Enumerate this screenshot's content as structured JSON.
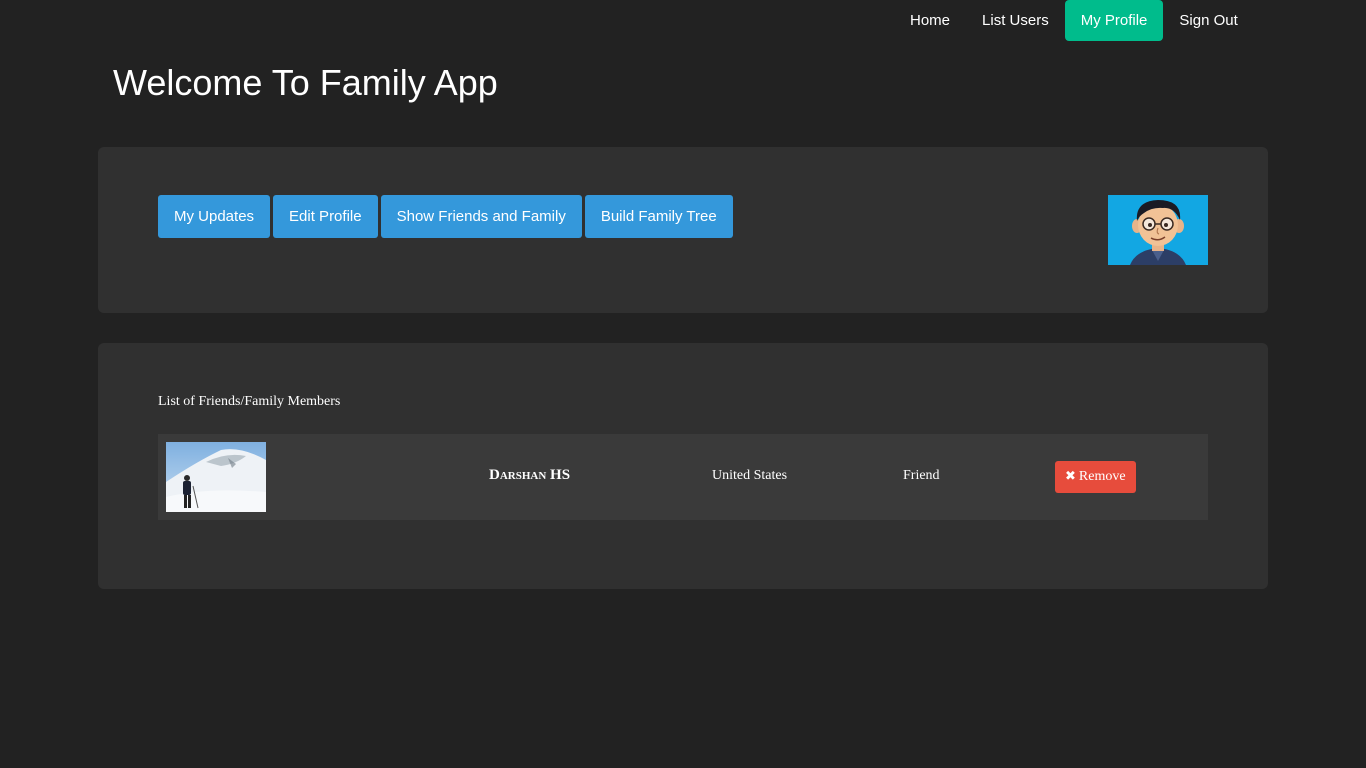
{
  "nav": {
    "items": [
      {
        "label": "Home"
      },
      {
        "label": "List Users"
      },
      {
        "label": "My Profile"
      },
      {
        "label": "Sign Out"
      }
    ],
    "active_color": "#00bc8c"
  },
  "page": {
    "title": "Welcome To Family App"
  },
  "profile_actions": {
    "buttons": [
      {
        "label": "My Updates"
      },
      {
        "label": "Edit Profile"
      },
      {
        "label": "Show Friends and Family"
      },
      {
        "label": "Build Family Tree"
      }
    ],
    "button_color": "#3498db",
    "avatar_icon": "cartoon-man-avatar"
  },
  "members": {
    "heading": "List of Friends/Family Members",
    "rows": [
      {
        "photo_icon": "snowy-mountain-hiker-photo",
        "name": "Darshan HS",
        "country": "United States",
        "relation": "Friend",
        "remove_label": "Remove",
        "remove_icon": "times-icon"
      }
    ],
    "remove_color": "#e74c3c"
  },
  "colors": {
    "background": "#222222",
    "panel": "#303030",
    "row": "#3a3a3a"
  }
}
